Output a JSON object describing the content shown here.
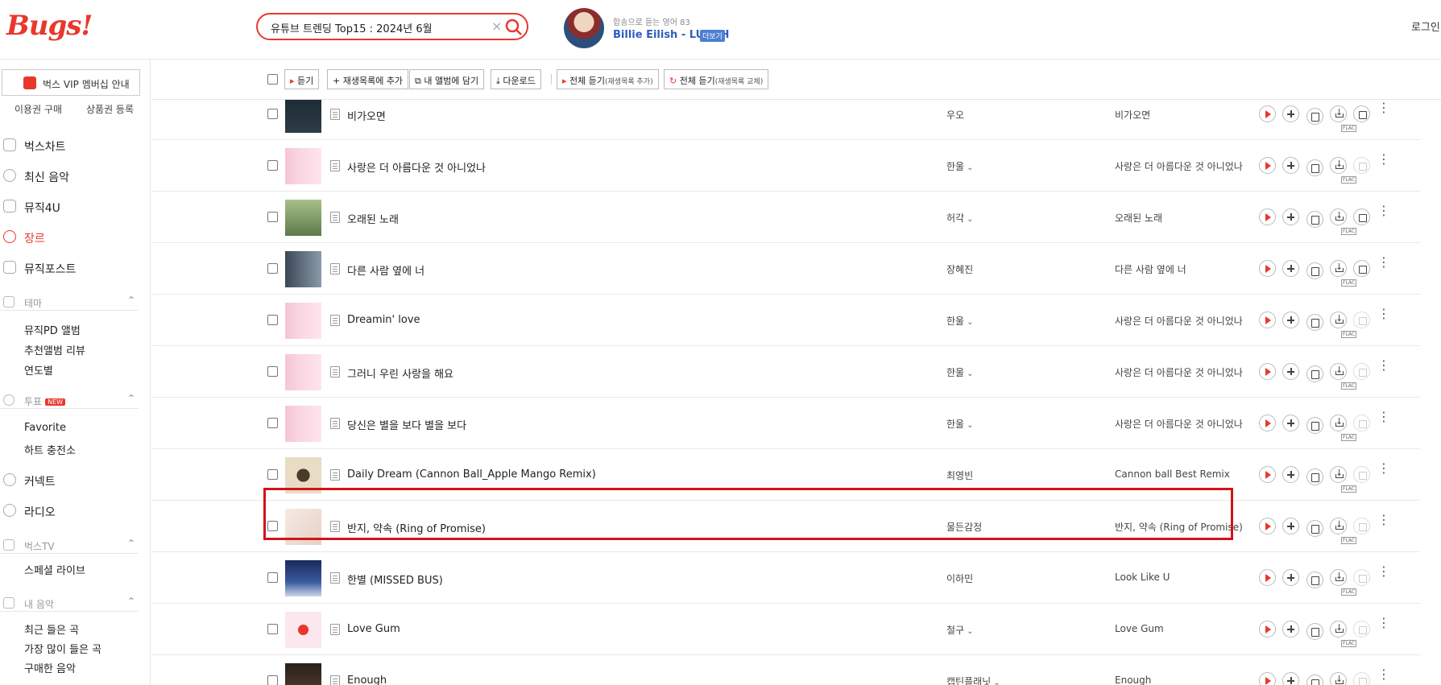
{
  "header": {
    "logo": "Bugs!",
    "search_value": "유튜브 트렌딩 Top15 : 2024년 6월",
    "now_playing_sub": "합송으로 듣는 영어 83",
    "now_playing_title": "Billie Eilish - LUNCH",
    "now_playing_badge": "더보기",
    "login": "로그인 /"
  },
  "sidebar": {
    "vip_label": "벅스 VIP 멤버십 안내",
    "sub_links": [
      "이용권 구매",
      "상품권 등록"
    ],
    "nav": [
      {
        "label": "벅스차트",
        "active": false
      },
      {
        "label": "최신 음악",
        "active": false
      },
      {
        "label": "뮤직4U",
        "active": false
      },
      {
        "label": "장르",
        "active": true
      },
      {
        "label": "뮤직포스트",
        "active": false
      }
    ],
    "theme": {
      "label": "테마",
      "items": [
        "뮤직PD 앨범",
        "추천앨범 리뷰",
        "연도별"
      ]
    },
    "vote": {
      "label": "투표",
      "badge": "NEW",
      "items": [
        "Favorite",
        "하트 충전소"
      ]
    },
    "connect": "커넥트",
    "radio": "라디오",
    "bugstv": {
      "label": "벅스TV",
      "items": [
        "스페셜 라이브"
      ]
    },
    "mymusic": {
      "label": "내 음악",
      "items": [
        "최근 들은 곡",
        "가장 많이 들은 곡",
        "구매한 음악"
      ]
    }
  },
  "toolbar": {
    "listen": "듣기",
    "add_playlist": "재생목록에 추가",
    "add_album": "내 앨범에 담기",
    "download": "다운로드",
    "play_all_add": "전체 듣기",
    "play_all_add_note": "(재생목록 추가)",
    "play_all_replace": "전체 듣기",
    "play_all_replace_note": "(재생목록 교체)"
  },
  "tracks": [
    {
      "title": "비가오면",
      "artist": "우오",
      "album": "비가오면",
      "has_menu": false,
      "mv": true
    },
    {
      "title": "사랑은 더 아름다운 것 아니었나",
      "artist": "한울",
      "album": "사랑은 더 아름다운 것 아니었나",
      "has_menu": true,
      "mv": false
    },
    {
      "title": "오래된 노래",
      "artist": "허각",
      "album": "오래된 노래",
      "has_menu": true,
      "mv": true
    },
    {
      "title": "다른 사람 옆에 너",
      "artist": "장혜진",
      "album": "다른 사람 옆에 너",
      "has_menu": false,
      "mv": true
    },
    {
      "title": "Dreamin' love",
      "artist": "한울",
      "album": "사랑은 더 아름다운 것 아니었나",
      "has_menu": true,
      "mv": false
    },
    {
      "title": "그러니 우린 사랑을 해요",
      "artist": "한울",
      "album": "사랑은 더 아름다운 것 아니었나",
      "has_menu": true,
      "mv": false
    },
    {
      "title": "당신은 별을 보다 별을 보다",
      "artist": "한울",
      "album": "사랑은 더 아름다운 것 아니었나",
      "has_menu": true,
      "mv": false
    },
    {
      "title": "Daily Dream (Cannon Ball_Apple Mango Remix)",
      "artist": "최영빈",
      "album": "Cannon ball Best Remix",
      "has_menu": false,
      "mv": false
    },
    {
      "title": "반지, 약속 (Ring of Promise)",
      "artist": "물든감정",
      "album": "반지, 약속 (Ring of Promise)",
      "has_menu": false,
      "mv": false
    },
    {
      "title": "한별 (MISSED BUS)",
      "artist": "이하민",
      "album": "Look Like U",
      "has_menu": false,
      "mv": false
    },
    {
      "title": "Love Gum",
      "artist": "철구",
      "album": "Love Gum",
      "has_menu": true,
      "mv": false
    },
    {
      "title": "Enough",
      "artist": "캡틴플래닛",
      "album": "Enough",
      "has_menu": true,
      "mv": false
    }
  ],
  "flac_label": "FLAC",
  "colors": {
    "brand": "#e8382d",
    "highlight": "#d2131a",
    "link": "#2d5dbf"
  }
}
